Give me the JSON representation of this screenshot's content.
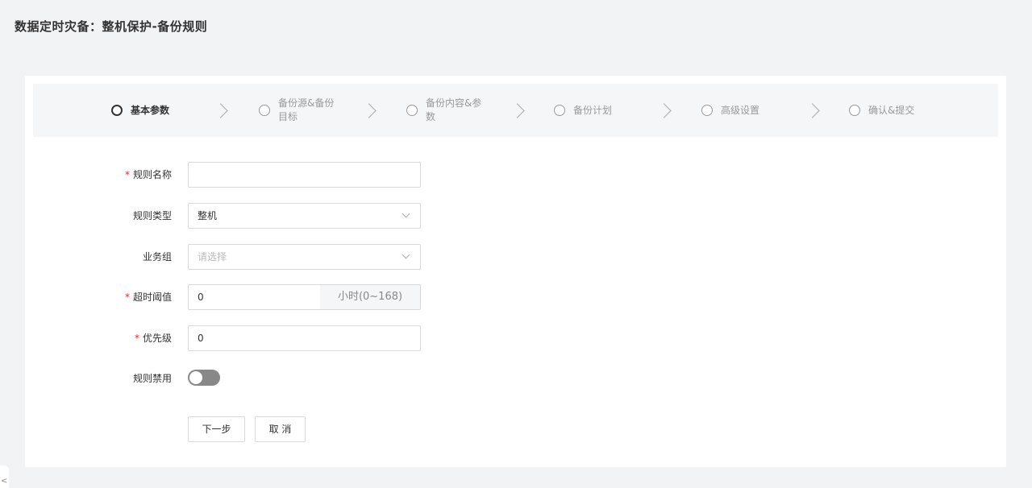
{
  "header": {
    "title": "数据定时灾备：整机保护-备份规则"
  },
  "steps": [
    {
      "label": "基本参数",
      "active": true
    },
    {
      "label": "备份源&备份目标",
      "active": false
    },
    {
      "label": "备份内容&参数",
      "active": false
    },
    {
      "label": "备份计划",
      "active": false
    },
    {
      "label": "高级设置",
      "active": false
    },
    {
      "label": "确认&提交",
      "active": false
    }
  ],
  "form": {
    "required_mark": "*",
    "rule_name": {
      "label": "规则名称",
      "value": ""
    },
    "rule_type": {
      "label": "规则类型",
      "value": "整机"
    },
    "business_group": {
      "label": "业务组",
      "placeholder": "请选择"
    },
    "timeout": {
      "label": "超时阈值",
      "value": "0",
      "unit": "小时(0~168)"
    },
    "priority": {
      "label": "优先级",
      "value": "0"
    },
    "rule_disable": {
      "label": "规则禁用",
      "enabled": false
    }
  },
  "actions": {
    "next_label": "下一步",
    "cancel_label": "取 消"
  },
  "sidebar_toggle": {
    "glyph": "<"
  }
}
